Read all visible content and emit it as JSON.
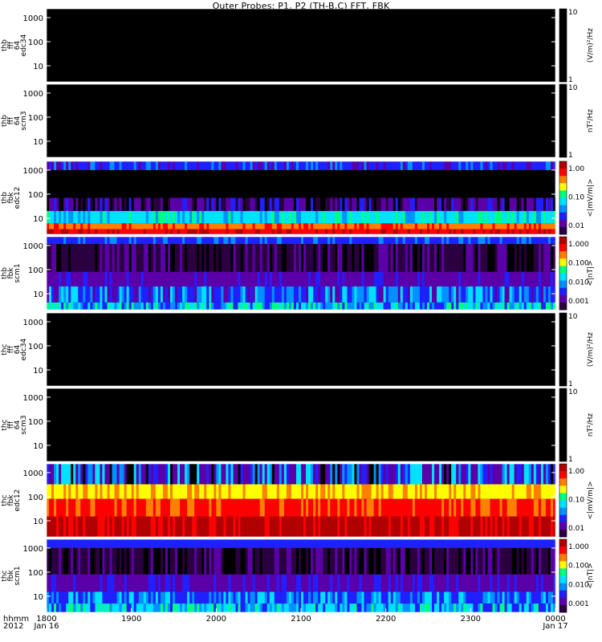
{
  "title": "Outer Probes: P1, P2 (TH-B,C) FFT, FBK",
  "chart_data": {
    "type": "heatmap",
    "title": "Outer Probes: P1, P2 (TH-B,C) FFT, FBK",
    "xaxis": {
      "corner_labels": [
        "hhmm",
        "2012"
      ],
      "ticks": [
        {
          "hhmm": "1800",
          "date": "Jan 16"
        },
        {
          "hhmm": "1900",
          "date": ""
        },
        {
          "hhmm": "2000",
          "date": ""
        },
        {
          "hhmm": "2100",
          "date": ""
        },
        {
          "hhmm": "2200",
          "date": ""
        },
        {
          "hhmm": "2300",
          "date": ""
        },
        {
          "hhmm": "0000",
          "date": "Jan 17"
        }
      ]
    },
    "panels": [
      {
        "probe": "thb",
        "ylabel": [
          "thb",
          "fff",
          "64",
          "edc34"
        ],
        "yticks": [
          "1000",
          "100",
          "10"
        ],
        "colorbar_unit": "(V/m)²/Hz",
        "colorbar_ticks": [
          "10",
          "1"
        ],
        "colorbar": "white",
        "pattern": "empty"
      },
      {
        "probe": "thb",
        "ylabel": [
          "thb",
          "fff",
          "64",
          "scm3"
        ],
        "yticks": [
          "1000",
          "100",
          "10"
        ],
        "colorbar_unit": "nT²/Hz",
        "colorbar_ticks": [
          "10",
          "1"
        ],
        "colorbar": "white",
        "pattern": "empty"
      },
      {
        "probe": "thb",
        "ylabel": [
          "thb",
          "fbk",
          "edc12"
        ],
        "yticks": [
          "1000",
          "100",
          "10"
        ],
        "colorbar_unit": "<|mV/m|>",
        "colorbar_ticks": [
          "1.00",
          "0.10",
          "0.01"
        ],
        "colorbar": "rainbow",
        "pattern": "fbk_e_b"
      },
      {
        "probe": "thb",
        "ylabel": [
          "thb",
          "fbk",
          "scm1"
        ],
        "yticks": [
          "1000",
          "100",
          "10"
        ],
        "colorbar_unit": "<|nT|>",
        "colorbar_ticks": [
          "1.000",
          "0.100",
          "0.010",
          "0.001"
        ],
        "colorbar": "rainbow",
        "pattern": "fbk_b_b"
      },
      {
        "probe": "thc",
        "ylabel": [
          "thc",
          "fff",
          "64",
          "edc34"
        ],
        "yticks": [
          "1000",
          "100",
          "10"
        ],
        "colorbar_unit": "(V/m)²/Hz",
        "colorbar_ticks": [
          "10",
          "1"
        ],
        "colorbar": "white",
        "pattern": "empty"
      },
      {
        "probe": "thc",
        "ylabel": [
          "thc",
          "fff",
          "64",
          "scm3"
        ],
        "yticks": [
          "1000",
          "100",
          "10"
        ],
        "colorbar_unit": "nT²/Hz",
        "colorbar_ticks": [
          "10",
          "1"
        ],
        "colorbar": "white",
        "pattern": "empty"
      },
      {
        "probe": "thc",
        "ylabel": [
          "thc",
          "fbk",
          "edc12"
        ],
        "yticks": [
          "1000",
          "100",
          "10"
        ],
        "colorbar_unit": "<|mV/m|>",
        "colorbar_ticks": [
          "1.00",
          "0.10",
          "0.01"
        ],
        "colorbar": "rainbow",
        "pattern": "fbk_e_c"
      },
      {
        "probe": "thc",
        "ylabel": [
          "thc",
          "fbk",
          "scm1"
        ],
        "yticks": [
          "1000",
          "100",
          "10"
        ],
        "colorbar_unit": "<|nT|>",
        "colorbar_ticks": [
          "1.000",
          "0.100",
          "0.010",
          "0.001"
        ],
        "colorbar": "rainbow",
        "pattern": "fbk_b_c"
      }
    ],
    "colors": {
      "background": "#000000",
      "rainbow": [
        "#2a0040",
        "#5b00a8",
        "#2020ff",
        "#0090ff",
        "#00e0ff",
        "#00ff80",
        "#ffff00",
        "#ff8000",
        "#ff0000",
        "#b00000"
      ]
    }
  }
}
